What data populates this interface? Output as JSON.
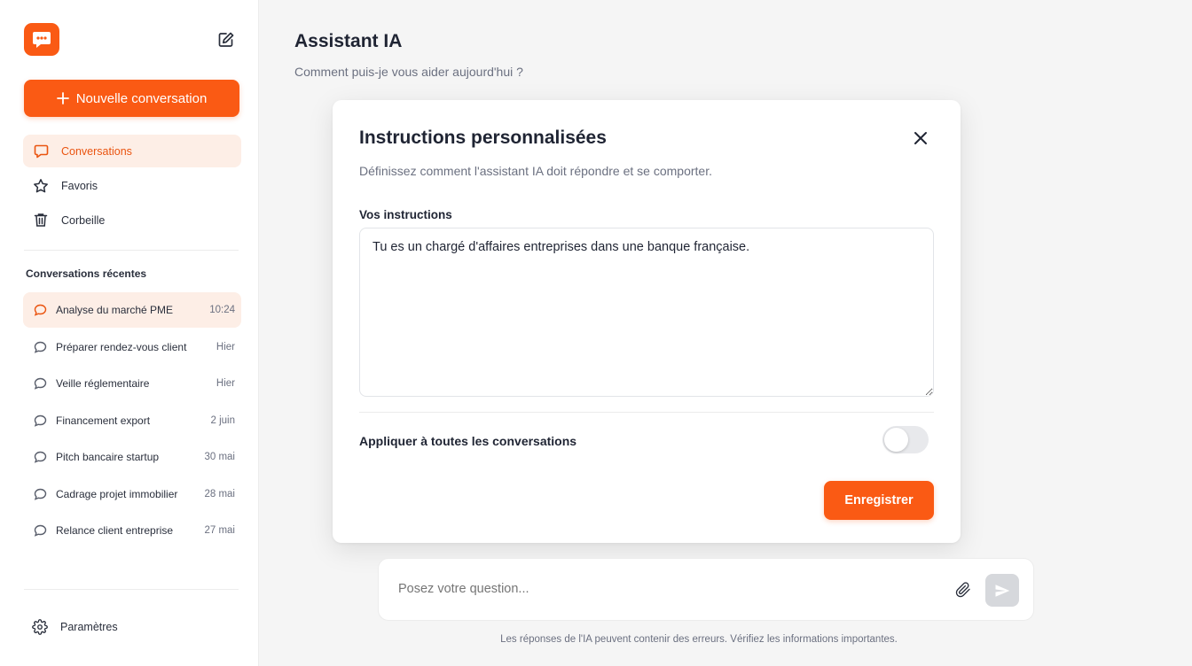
{
  "sidebar": {
    "new_conversation_label": "Nouvelle conversation",
    "nav": [
      {
        "label": "Conversations",
        "icon": "chat-bubble-icon",
        "active": true
      },
      {
        "label": "Favoris",
        "icon": "star-icon",
        "active": false
      },
      {
        "label": "Corbeille",
        "icon": "trash-icon",
        "active": false
      }
    ],
    "recent_title": "Conversations récentes",
    "recent": [
      {
        "title": "Analyse du marché PME",
        "time": "10:24",
        "active": true
      },
      {
        "title": "Préparer rendez-vous client",
        "time": "Hier",
        "active": false
      },
      {
        "title": "Veille réglementaire",
        "time": "Hier",
        "active": false
      },
      {
        "title": "Financement export",
        "time": "2 juin",
        "active": false
      },
      {
        "title": "Pitch bancaire startup",
        "time": "30 mai",
        "active": false
      },
      {
        "title": "Cadrage projet immobilier",
        "time": "28 mai",
        "active": false
      },
      {
        "title": "Relance client entreprise",
        "time": "27 mai",
        "active": false
      }
    ],
    "settings_label": "Paramètres"
  },
  "main": {
    "title": "Assistant IA",
    "subtitle": "Comment puis-je vous aider aujourd'hui ?",
    "composer": {
      "placeholder": "Posez votre question..."
    },
    "disclaimer": "Les réponses de l'IA peuvent contenir des erreurs. Vérifiez les informations importantes."
  },
  "modal": {
    "title": "Instructions personnalisées",
    "description": "Définissez comment l'assistant IA doit répondre et se comporter.",
    "field_label": "Vos instructions",
    "instructions_value": "Tu es un chargé d'affaires entreprises dans une banque française.",
    "toggle_label": "Appliquer à toutes les conversations",
    "toggle_on": false,
    "save_label": "Enregistrer"
  },
  "colors": {
    "accent": "#fa5a14",
    "accent_light": "#fdeee6",
    "text": "#1f2433",
    "muted": "#6b7080"
  }
}
